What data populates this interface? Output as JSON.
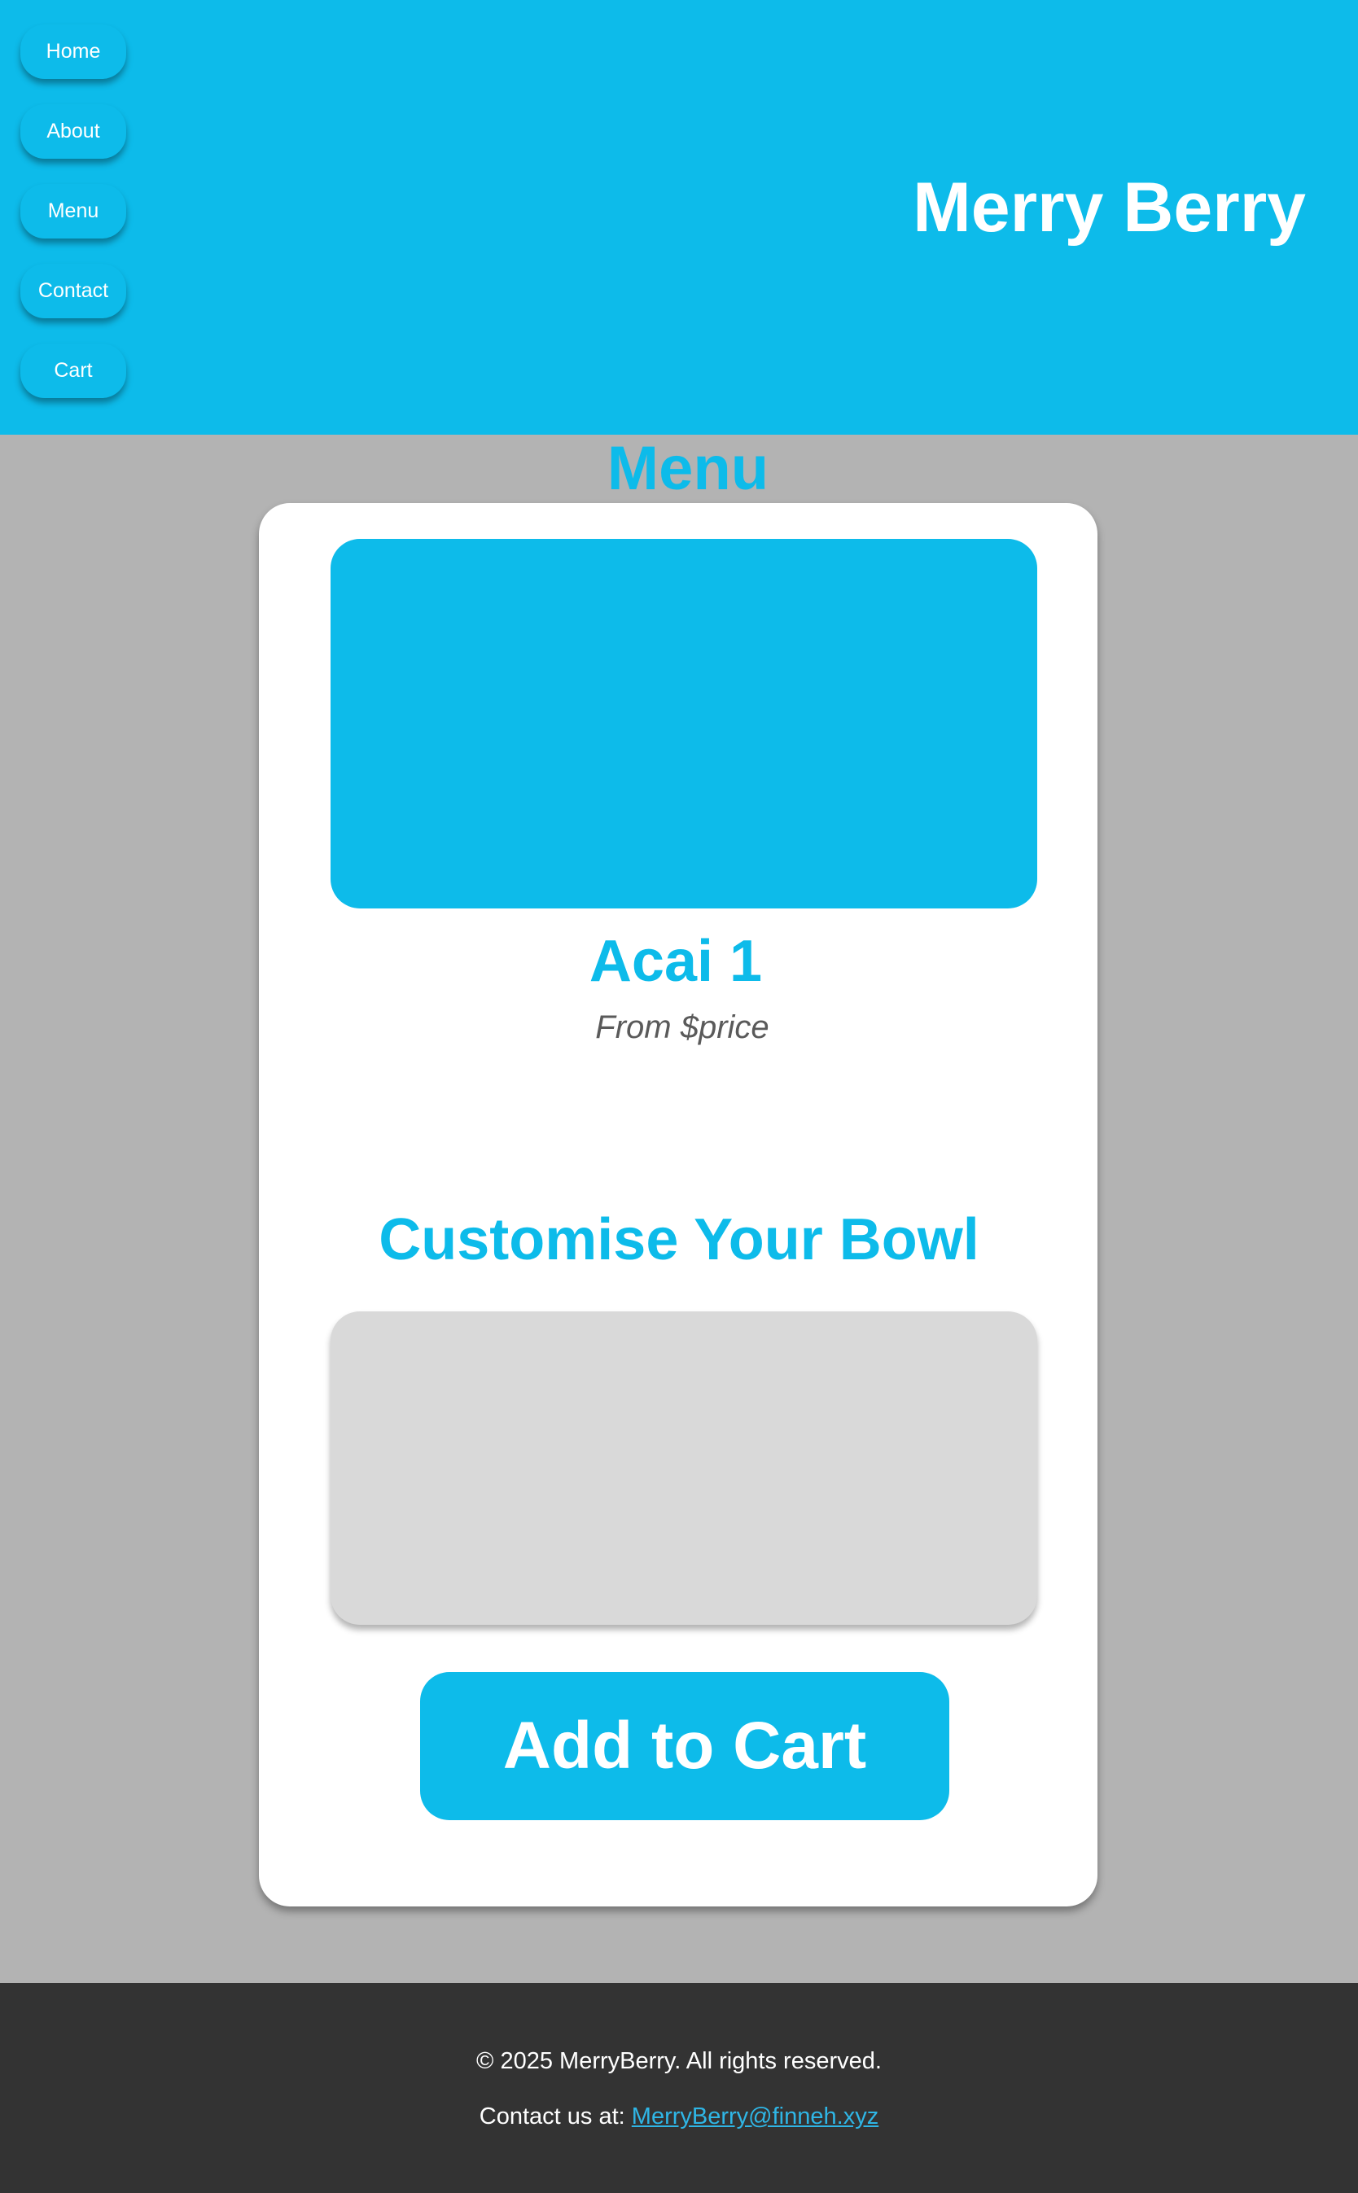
{
  "header": {
    "site_title": "Merry Berry",
    "nav": [
      {
        "label": "Home"
      },
      {
        "label": "About"
      },
      {
        "label": "Menu"
      },
      {
        "label": "Contact"
      },
      {
        "label": "Cart"
      }
    ]
  },
  "main": {
    "heading": "Menu",
    "item": {
      "name": "Acai 1",
      "price": "From $price"
    },
    "customise_heading": "Customise Your Bowl",
    "add_to_cart_label": "Add to Cart"
  },
  "footer": {
    "copyright": "© 2025 MerryBerry. All rights reserved.",
    "contact_prefix": "Contact us at:",
    "contact_email": "MerryBerry@finneh.xyz"
  },
  "colors": {
    "brand": "#0dbbea",
    "background": "#b3b3b3",
    "footer": "#333333",
    "card": "#ffffff",
    "placeholder": "#d9d9d9"
  }
}
